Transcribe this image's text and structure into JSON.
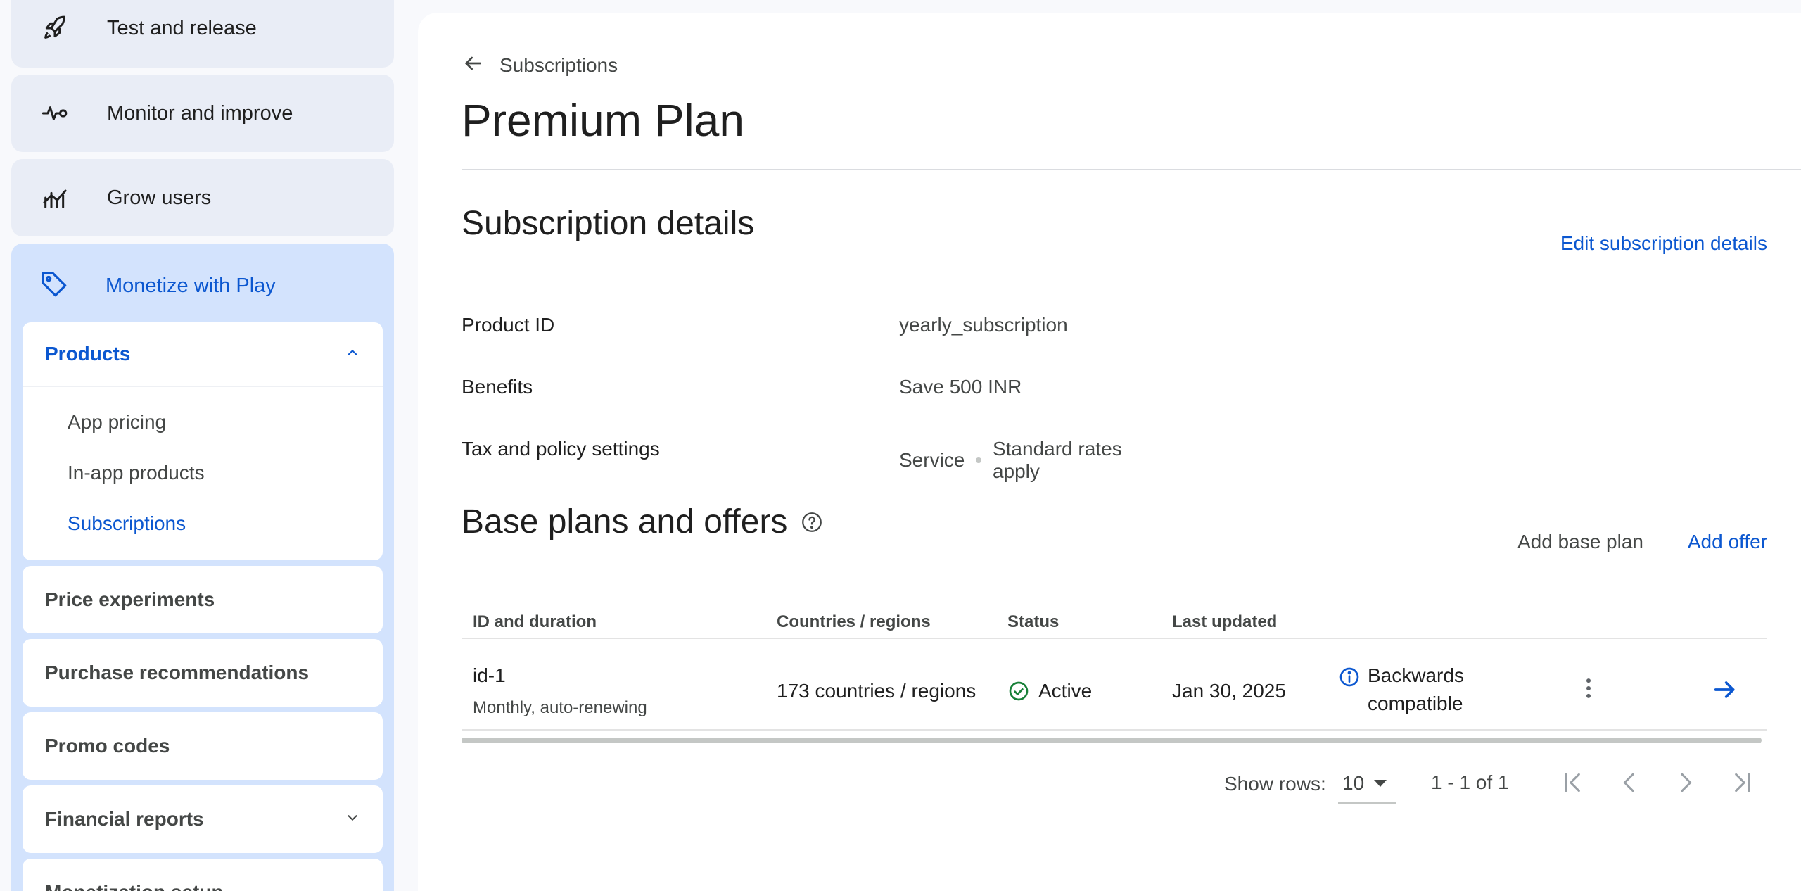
{
  "sidebar": {
    "nav": [
      {
        "label": "Test and release",
        "icon": "rocket-icon"
      },
      {
        "label": "Monitor and improve",
        "icon": "pulse-icon"
      },
      {
        "label": "Grow users",
        "icon": "growth-chart-icon"
      }
    ],
    "monetize": {
      "label": "Monetize with Play",
      "icon": "tag-icon"
    },
    "products": {
      "label": "Products",
      "items": [
        {
          "label": "App pricing"
        },
        {
          "label": "In-app products"
        },
        {
          "label": "Subscriptions"
        }
      ]
    },
    "cards": [
      {
        "label": "Price experiments"
      },
      {
        "label": "Purchase recommendations"
      },
      {
        "label": "Promo codes"
      },
      {
        "label": "Financial reports"
      },
      {
        "label": "Monetization setup"
      }
    ]
  },
  "main": {
    "back_label": "Subscriptions",
    "title": "Premium Plan",
    "details": {
      "title": "Subscription details",
      "edit_label": "Edit subscription details",
      "rows": [
        {
          "key": "Product ID",
          "value": "yearly_subscription"
        },
        {
          "key": "Benefits",
          "value": "Save 500 INR"
        },
        {
          "key": "Tax and policy settings",
          "value_a": "Service",
          "value_b": "Standard rates apply"
        }
      ]
    },
    "plans": {
      "title": "Base plans and offers",
      "add_base_label": "Add base plan",
      "add_offer_label": "Add offer",
      "columns": [
        "ID and duration",
        "Countries / regions",
        "Status",
        "Last updated"
      ],
      "rows": [
        {
          "id": "id-1",
          "duration": "Monthly, auto-renewing",
          "countries": "173 countries / regions",
          "status": "Active",
          "updated": "Jan 30, 2025",
          "compat": "Backwards compatible"
        }
      ],
      "pagination": {
        "show_rows_label": "Show rows:",
        "rows_value": "10",
        "range": "1 - 1 of 1"
      }
    }
  },
  "colors": {
    "accent": "#0b57d0",
    "active_green": "#188038",
    "nav_bg": "#e9edf6",
    "monetize_bg": "#d3e3fd"
  }
}
